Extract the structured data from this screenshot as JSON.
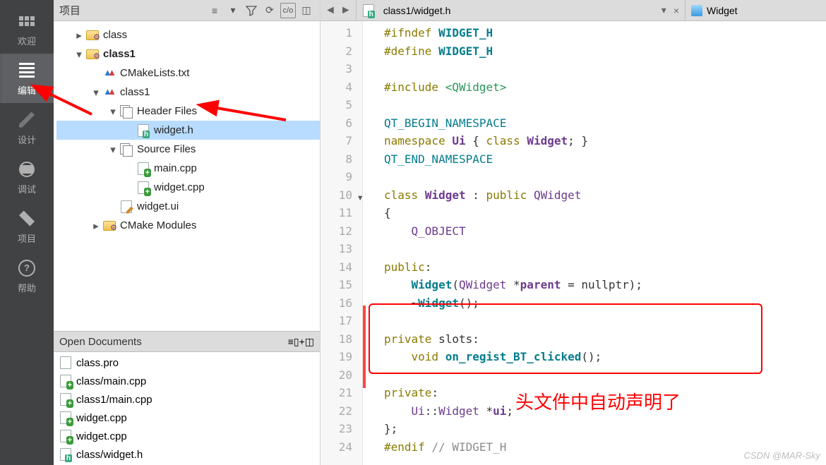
{
  "leftnav": {
    "welcome": "欢迎",
    "edit": "编辑",
    "design": "设计",
    "debug": "调试",
    "project": "项目",
    "help": "帮助"
  },
  "panel": {
    "title": "项目",
    "tree": {
      "class": "class",
      "class1": "class1",
      "cmakelists": "CMakeLists.txt",
      "class1_sub": "class1",
      "header_files": "Header Files",
      "widget_h": "widget.h",
      "source_files": "Source Files",
      "main_cpp": "main.cpp",
      "widget_cpp": "widget.cpp",
      "widget_ui": "widget.ui",
      "cmake_modules": "CMake Modules"
    }
  },
  "open_docs": {
    "title": "Open Documents",
    "items": [
      "class.pro",
      "class/main.cpp",
      "class1/main.cpp",
      "widget.cpp",
      "widget.cpp",
      "class/widget.h"
    ]
  },
  "editor_top": {
    "file": "class1/widget.h",
    "side": "Widget"
  },
  "code": {
    "lines": [
      "1",
      "2",
      "3",
      "4",
      "5",
      "6",
      "7",
      "8",
      "9",
      "10",
      "11",
      "12",
      "13",
      "14",
      "15",
      "16",
      "17",
      "18",
      "19",
      "20",
      "21",
      "22",
      "23",
      "24"
    ],
    "l1a": "#ifndef",
    "l1b": "WIDGET_H",
    "l2a": "#define",
    "l2b": "WIDGET_H",
    "l4a": "#include",
    "l4b": "<QWidget>",
    "l6": "QT_BEGIN_NAMESPACE",
    "l7a": "namespace",
    "l7b": "Ui",
    "l7c": "{",
    "l7d": "class",
    "l7e": "Widget",
    "l7f": "; }",
    "l8": "QT_END_NAMESPACE",
    "l10a": "class",
    "l10b": "Widget",
    "l10c": " : ",
    "l10d": "public",
    "l10e": "QWidget",
    "l11": "{",
    "l12": "Q_OBJECT",
    "l14": "public",
    "l15a": "Widget",
    "l15b": "(",
    "l15c": "QWidget",
    "l15d": " *",
    "l15e": "parent",
    "l15f": " = nullptr);",
    "l16": "~",
    "l16b": "Widget",
    "l16c": "();",
    "l18a": "private",
    "l18b": " slots:",
    "l19a": "void",
    "l19b": "on_regist_BT_clicked",
    "l19c": "();",
    "l21": "private",
    "l22a": "Ui",
    "l22b": "::",
    "l22c": "Widget",
    "l22d": " *",
    "l22e": "ui",
    "l22f": ";",
    "l23": "};",
    "l24a": "#endif",
    "l24b": "// WIDGET_H"
  },
  "annotation": "头文件中自动声明了",
  "watermark": "CSDN @MAR-Sky"
}
